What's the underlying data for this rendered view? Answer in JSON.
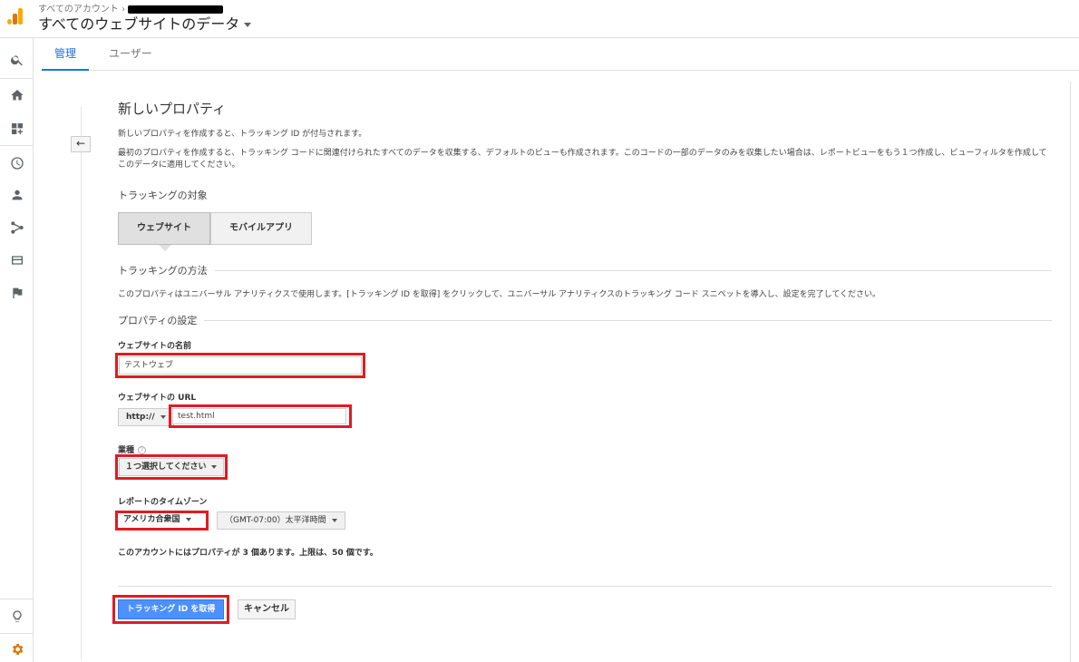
{
  "header": {
    "breadcrumb": "すべてのアカウント ›",
    "account_title": "すべてのウェブサイトのデータ"
  },
  "nav_icons": [
    "search-icon",
    "home-icon",
    "dashboard-add-icon",
    "clock-icon",
    "person-icon",
    "acquisition-icon",
    "behavior-icon",
    "flag-icon",
    "lightbulb-icon",
    "gear-icon"
  ],
  "tabs": [
    {
      "label": "管理",
      "active": true
    },
    {
      "label": "ユーザー",
      "active": false
    }
  ],
  "back_button": "←",
  "form": {
    "title": "新しいプロパティ",
    "intro": "新しいプロパティを作成すると、トラッキング ID が付与されます。",
    "description": "最初のプロパティを作成すると、トラッキング コードに関連付けられたすべてのデータを収集する、デフォルトのビューも作成されます。このコードの一部のデータのみを収集したい場合は、レポートビューをもう１つ作成し、ビューフィルタを作成してこのデータに適用してください。",
    "tracking_target_label": "トラッキングの対象",
    "target_options": [
      "ウェブサイト",
      "モバイルアプリ"
    ],
    "selected_target": "ウェブサイト",
    "tracking_method_label": "トラッキングの方法",
    "tracking_method_text": "このプロパティはユニバーサル アナリティクスで使用します。[トラッキング ID を取得] をクリックして、ユニバーサル アナリティクスのトラッキング コード スニペットを導入し、設定を完了してください。",
    "property_settings_label": "プロパティの設定",
    "site_name_label": "ウェブサイトの名前",
    "site_name_value": "テストウェブ",
    "site_url_label": "ウェブサイトの URL",
    "protocol_value": "http://",
    "site_url_value": "test.html",
    "industry_label": "業種",
    "industry_help": "?",
    "industry_value": "１つ選択してください",
    "timezone_label": "レポートのタイムゾーン",
    "country_value": "アメリカ合衆国",
    "timezone_value": "（GMT-07:00）太平洋時間",
    "quota_text": "このアカウントにはプロパティが 3 個あります。上限は、50 個です。",
    "submit_label": "トラッキング ID を取得",
    "cancel_label": "キャンセル"
  },
  "colors": {
    "accent": "#1a73e8",
    "highlight_box": "#e01b23",
    "primary_button": "#4d90fe"
  }
}
